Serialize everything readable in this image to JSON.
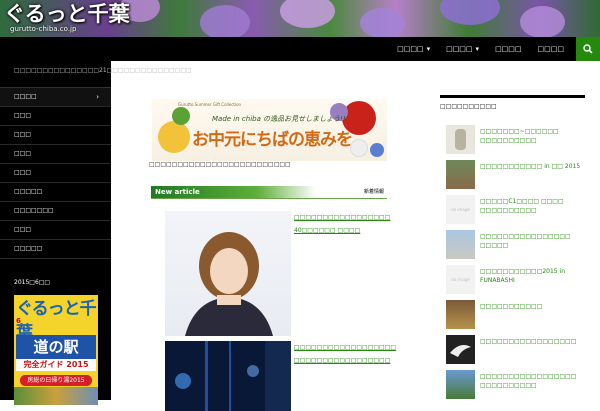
{
  "header": {
    "logo_text": "ぐるっと千葉",
    "logo_url": "gurutto-chiba.co.jp"
  },
  "top_nav": {
    "items": [
      {
        "label": "□□□□",
        "has_dropdown": true
      },
      {
        "label": "□□□□",
        "has_dropdown": true
      },
      {
        "label": "□□□□",
        "has_dropdown": false
      },
      {
        "label": "□□□□",
        "has_dropdown": false
      }
    ],
    "search_icon": "search-icon"
  },
  "sidebar_left": {
    "site_description": "□□□□□□□□□□□□□□□21□□□□□□□□□□□□□□□",
    "menu": [
      {
        "label": "□□□□",
        "has_submenu": true
      },
      {
        "label": "□□□",
        "has_submenu": false
      },
      {
        "label": "□□□",
        "has_submenu": false
      },
      {
        "label": "□□□",
        "has_submenu": false
      },
      {
        "label": "□□□",
        "has_submenu": false
      },
      {
        "label": "□□□□□",
        "has_submenu": false
      },
      {
        "label": "□□□□□□□",
        "has_submenu": false
      },
      {
        "label": "□□□",
        "has_submenu": false
      },
      {
        "label": "□□□□□",
        "has_submenu": false
      }
    ],
    "magazine_heading": "2015□6□□",
    "magazine": {
      "title": "ぐるっと千葉",
      "issue": "6",
      "band": "道の駅",
      "subtitle": "完全ガイド 2015",
      "pill": "房総の日帰り湯2015"
    }
  },
  "main": {
    "banner": {
      "top_line": "Gurutto Summer Gift Collection",
      "tagline": "Made in chiba の逸品お見せしましょう!!",
      "title": "お中元にちばの恵みを"
    },
    "intro": "□□□□□□□□□□□□□□□□□□□□□□□□□",
    "new_article": {
      "en": "New article",
      "jp": "新着情報"
    },
    "posts": [
      {
        "title": "□□□□□□□□□□□□□□□□□ 40□□□□□□ □□□□"
      },
      {
        "title": "□□□□□□□□□□□□□□□□□□ □□□□□□□□□□□□□□□□□"
      }
    ]
  },
  "sidebar_right": {
    "heading": "□□□□□□□□□□",
    "items": [
      {
        "title": "□□□□□□□~□□□□□□ □□□□□□□□□□",
        "thumb": "image"
      },
      {
        "title": "□□□□□□□□□□□ in □□ 2015",
        "thumb": "image"
      },
      {
        "title": "□□□□□C1□□□□ □□□□ □□□□□□□□□□",
        "thumb": "no-image"
      },
      {
        "title": "□□□□□□□□□□□□□□□□ □□□□□",
        "thumb": "image"
      },
      {
        "title": "□□□□□□□□□□□2015 in FUNABASHI",
        "thumb": "no-image"
      },
      {
        "title": "□□□□□□□□□□□",
        "thumb": "image"
      },
      {
        "title": "□□□□□□□□□□□□□□□□□",
        "thumb": "image"
      },
      {
        "title": "□□□□□□□□□□□□□□□□□ □□□□□□□□□□",
        "thumb": "image"
      }
    ],
    "no_image_label": "no image"
  },
  "colors": {
    "accent_green": "#24890d",
    "sidebar_black": "#000000"
  }
}
